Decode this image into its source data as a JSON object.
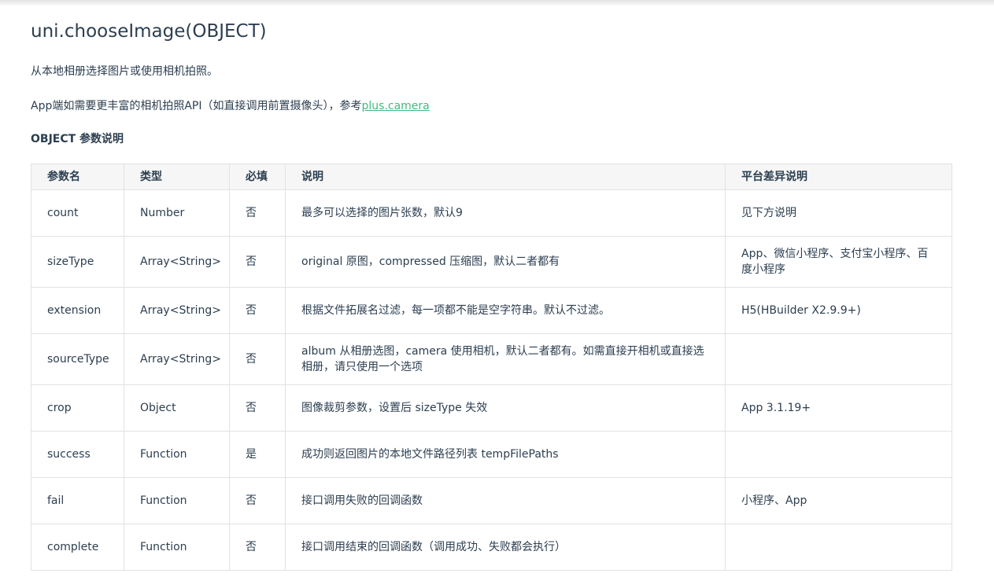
{
  "title": "uni.chooseImage(OBJECT)",
  "description": "从本地相册选择图片或使用相机拍照。",
  "app_note": {
    "text": "App端如需要更丰富的相机拍照API（如直接调用前置摄像头），参考",
    "link_label": "plus.camera"
  },
  "section_heading": "OBJECT 参数说明",
  "table": {
    "headers": [
      "参数名",
      "类型",
      "必填",
      "说明",
      "平台差异说明"
    ],
    "rows": [
      {
        "name": "count",
        "type": "Number",
        "required": "否",
        "desc": "最多可以选择的图片张数，默认9",
        "platform": "见下方说明"
      },
      {
        "name": "sizeType",
        "type": "Array<String>",
        "required": "否",
        "desc": "original 原图，compressed 压缩图，默认二者都有",
        "platform": "App、微信小程序、支付宝小程序、百度小程序"
      },
      {
        "name": "extension",
        "type": "Array<String>",
        "required": "否",
        "desc": "根据文件拓展名过滤，每一项都不能是空字符串。默认不过滤。",
        "platform": "H5(HBuilder X2.9.9+)"
      },
      {
        "name": "sourceType",
        "type": "Array<String>",
        "required": "否",
        "desc": "album 从相册选图，camera 使用相机，默认二者都有。如需直接开相机或直接选相册，请只使用一个选项",
        "platform": ""
      },
      {
        "name": "crop",
        "type": "Object",
        "required": "否",
        "desc": "图像裁剪参数，设置后 sizeType 失效",
        "platform": "App 3.1.19+"
      },
      {
        "name": "success",
        "type": "Function",
        "required": "是",
        "desc": "成功则返回图片的本地文件路径列表 tempFilePaths",
        "platform": ""
      },
      {
        "name": "fail",
        "type": "Function",
        "required": "否",
        "desc": "接口调用失败的回调函数",
        "platform": "小程序、App"
      },
      {
        "name": "complete",
        "type": "Function",
        "required": "否",
        "desc": "接口调用结束的回调函数（调用成功、失败都会执行）",
        "platform": ""
      }
    ]
  }
}
